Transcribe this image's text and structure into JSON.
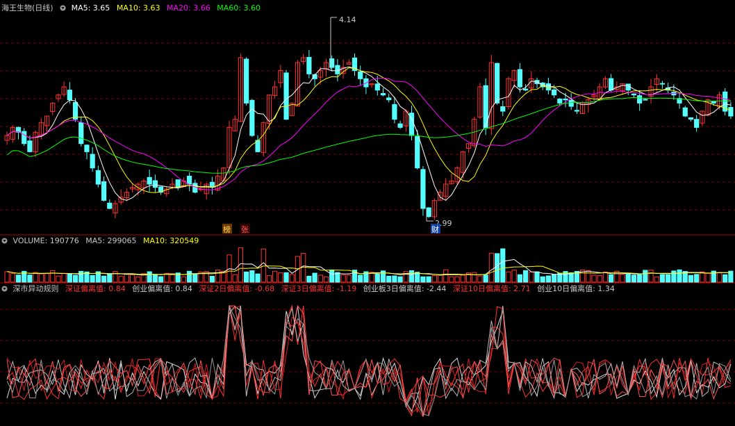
{
  "header": {
    "stock_name": "海王生物(日线)",
    "ma": [
      {
        "label": "MA5: 3.65",
        "color": "#ffffff"
      },
      {
        "label": "MA10: 3.63",
        "color": "#ffff00"
      },
      {
        "label": "MA20: 3.66",
        "color": "#ff00ff"
      },
      {
        "label": "MA60: 3.60",
        "color": "#00ff00"
      }
    ]
  },
  "volume_header": {
    "title": "VOLUME: 190776",
    "ma5": "MA5: 299065",
    "ma10": "MA10: 320549"
  },
  "indicator_header": {
    "name": "深市异动规则",
    "items": [
      {
        "label": "深证偏离值: 0.84",
        "color": "#ff3030"
      },
      {
        "label": "创业偏离值: 0.84",
        "color": "#c8c8c8"
      },
      {
        "label": "深证2日偏离值: -0.68",
        "color": "#ff3030"
      },
      {
        "label": "深证3日偏离值: -1.19",
        "color": "#ff3030"
      },
      {
        "label": "创业板3日偏离值: -2.44",
        "color": "#c8c8c8"
      },
      {
        "label": "深证10日偏离值: 2.71",
        "color": "#ff3030"
      },
      {
        "label": "创业10日偏离值: 1.34",
        "color": "#c8c8c8"
      }
    ]
  },
  "markers": {
    "high_label": "4.14",
    "low_label": "2.99",
    "badge_bang": "榜",
    "badge_zhang": "张",
    "badge_cai": "财"
  },
  "colors": {
    "up": "#ff3232",
    "down": "#54ffff",
    "ma5": "#ffffff",
    "ma10": "#ffff00",
    "ma20": "#ff00ff",
    "ma60": "#00ff00",
    "grid": "#7a0000",
    "divider": "#b00000"
  },
  "chart_data": {
    "type": "candlestick",
    "price_range": [
      2.9,
      4.25
    ],
    "high": 4.14,
    "low": 2.99,
    "closes": [
      3.5,
      3.55,
      3.52,
      3.45,
      3.4,
      3.52,
      3.58,
      3.62,
      3.7,
      3.75,
      3.8,
      3.72,
      3.6,
      3.45,
      3.4,
      3.3,
      3.2,
      3.1,
      3.05,
      3.08,
      3.12,
      3.15,
      3.18,
      3.2,
      3.22,
      3.2,
      3.18,
      3.15,
      3.17,
      3.2,
      3.18,
      3.22,
      3.2,
      3.15,
      3.17,
      3.2,
      3.18,
      3.25,
      3.3,
      3.55,
      3.6,
      3.98,
      3.7,
      3.5,
      3.4,
      3.58,
      3.75,
      3.8,
      3.9,
      3.6,
      3.7,
      3.95,
      3.98,
      3.88,
      3.85,
      3.9,
      3.95,
      3.92,
      3.88,
      3.92,
      3.95,
      3.9,
      3.85,
      3.8,
      3.82,
      3.78,
      3.75,
      3.72,
      3.6,
      3.55,
      3.65,
      3.5,
      3.3,
      3.05,
      3.0,
      3.1,
      3.15,
      3.2,
      3.22,
      3.3,
      3.4,
      3.45,
      3.6,
      3.8,
      3.55,
      3.95,
      3.7,
      3.65,
      3.85,
      3.9,
      3.8,
      3.78,
      3.85,
      3.82,
      3.8,
      3.78,
      3.75,
      3.7,
      3.72,
      3.68,
      3.65,
      3.7,
      3.72,
      3.75,
      3.8,
      3.85,
      3.78,
      3.8,
      3.82,
      3.78,
      3.75,
      3.7,
      3.72,
      3.8,
      3.85,
      3.82,
      3.78,
      3.75,
      3.7,
      3.62,
      3.6,
      3.55,
      3.65,
      3.72,
      3.7,
      3.75,
      3.65,
      3.62
    ]
  }
}
